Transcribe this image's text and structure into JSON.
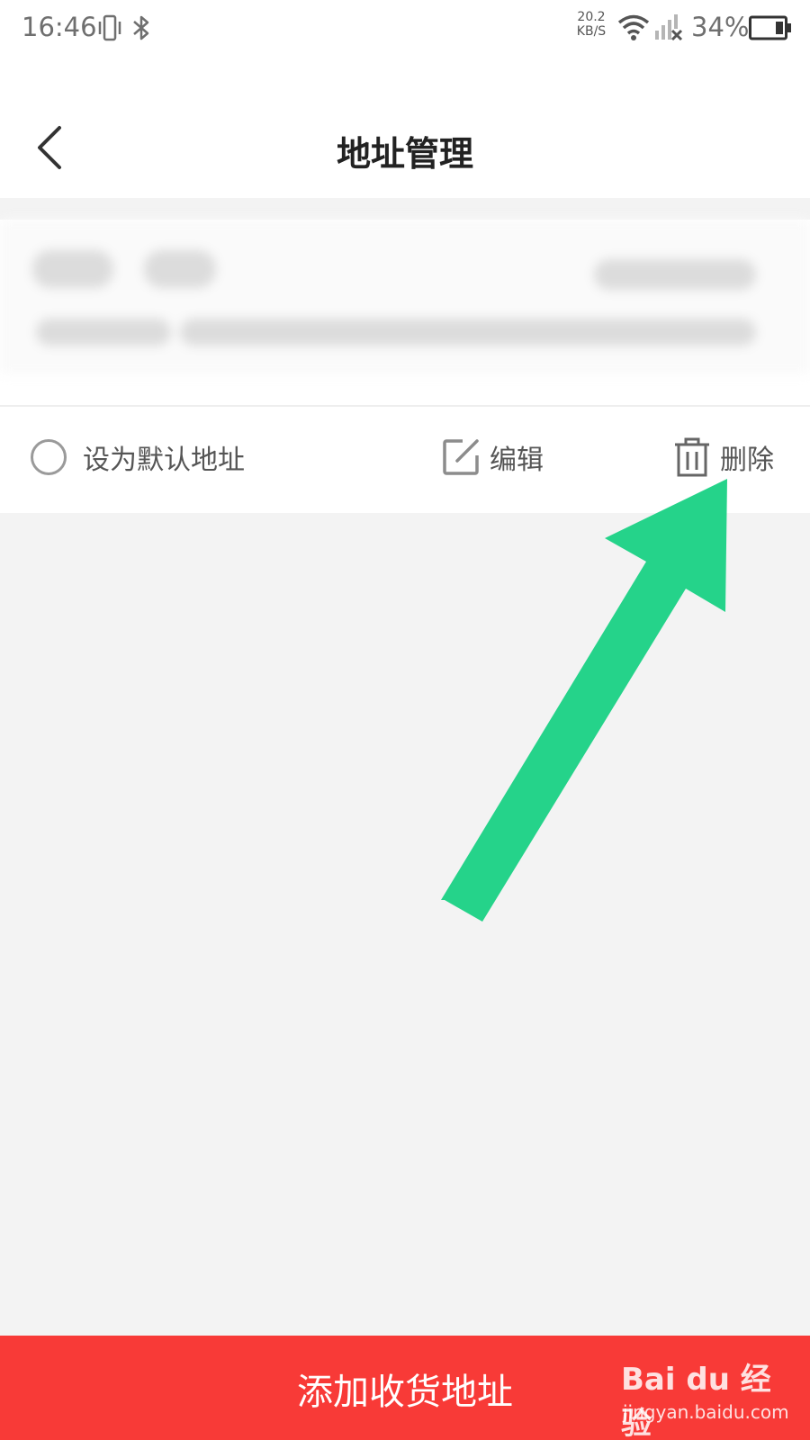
{
  "status_bar": {
    "time": "16:46",
    "net_speed_value": "20.2",
    "net_speed_unit": "KB/S",
    "battery_percent": "34%",
    "icons": [
      "vibrate-icon",
      "bluetooth-icon",
      "wifi-icon",
      "signal-off-icon",
      "battery-icon"
    ]
  },
  "header": {
    "title": "地址管理",
    "back_icon": "chevron-left-icon"
  },
  "address_card": {
    "actions": {
      "default_label": "设为默认地址",
      "edit_label": "编辑",
      "delete_label": "删除"
    }
  },
  "bottom_bar": {
    "label": "添加收货地址"
  },
  "watermark": {
    "logo_text": "Bai du 经验",
    "url": "jingyan.baidu.com"
  },
  "colors": {
    "accent_red": "#f83a37",
    "arrow_green": "#25d38a",
    "background": "#f3f3f3"
  }
}
